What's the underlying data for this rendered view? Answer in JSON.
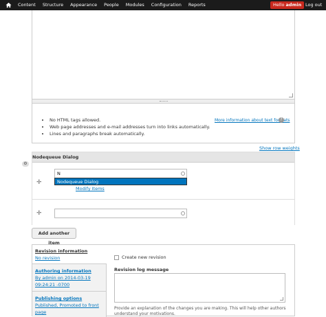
{
  "toolbar": {
    "menu": [
      "Content",
      "Structure",
      "Appearance",
      "People",
      "Modules",
      "Configuration",
      "Reports"
    ],
    "hello_prefix": "Hello ",
    "hello_user": "admin",
    "logout": "Log out"
  },
  "format": {
    "tips": [
      "No HTML tags allowed.",
      "Web page addresses and e-mail addresses turn into links automatically.",
      "Lines and paragraphs break automatically."
    ],
    "more_link": "More information about text formats"
  },
  "nodequeue": {
    "show_weights": "Show row weights",
    "header": "Nodequeue Dialog",
    "row1_value": "N",
    "suggestion": "Nodequeue Dialog",
    "modify": "Modify Items",
    "row2_value": ""
  },
  "add_item": "Add another item",
  "vtabs": [
    {
      "title": "Revision information",
      "summary": "No revision",
      "active": true
    },
    {
      "title": "Authoring information",
      "summary": "By admin on 2014-03-19 09:24:21 -0700",
      "active": false
    },
    {
      "title": "Publishing options",
      "summary": "Published, Promoted to front page",
      "active": false
    }
  ],
  "revision": {
    "checkbox_label": "Create new revision",
    "log_label": "Revision log message",
    "help": "Provide an explanation of the changes you are making. This will help other authors understand your motivations."
  },
  "colors": {
    "toolbar_bg": "#1b1b1b",
    "hello_bg": "#c8291e",
    "link": "#0074bd",
    "selected": "#0074bd"
  }
}
